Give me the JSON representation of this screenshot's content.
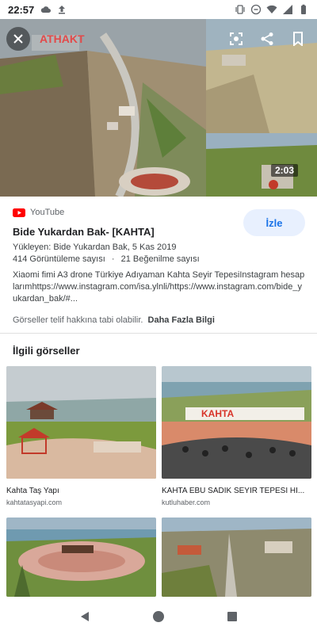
{
  "status_bar": {
    "time": "22:57",
    "left_icons": [
      "cloud-icon",
      "upload-icon"
    ],
    "right_icons": [
      "vibrate-icon",
      "minus-circle-icon",
      "wifi-icon",
      "signal-icon",
      "battery-icon"
    ]
  },
  "hero": {
    "duration": "2:03",
    "overlay_text": "ATHAKT",
    "buttons": [
      "close-icon",
      "lens-icon",
      "share-icon",
      "bookmark-icon"
    ]
  },
  "result": {
    "source": "YouTube",
    "title": "Bide Yukardan Bak- [KAHTA]",
    "visit_label": "İzle",
    "uploader_line": "Yükleyen: Bide Yukardan Bak, 5 Kas 2019",
    "views": "414 Görüntüleme sayısı",
    "separator": "·",
    "likes": "21 Beğenilme sayısı",
    "description": "Xiaomi fimi A3 drone Türkiye Adıyaman Kahta Seyir TepesiInstagram hesaplarımhttps://www.instagram.com/isa.ylnli/https://www.instagram.com/bide_yukardan_bak/#...",
    "copyright_text": "Görseller telif hakkına tabi olabilir.",
    "more_info": "Daha Fazla Bilgi"
  },
  "related": {
    "heading": "İlgili görseller",
    "items": [
      {
        "title": "Kahta Taş Yapı",
        "source": "kahtatasyapi.com"
      },
      {
        "title": "KAHTA EBU SADIK SEYİR TEPESİ Hİ...",
        "source": "kutluhaber.com"
      },
      {
        "title": "",
        "source": ""
      },
      {
        "title": "",
        "source": ""
      }
    ]
  },
  "nav": {
    "icons": [
      "back-icon",
      "home-icon",
      "recents-icon"
    ]
  },
  "colors": {
    "accent": "#1a73e8",
    "visit_bg": "#e8f0fe",
    "youtube_red": "#ff0000"
  }
}
